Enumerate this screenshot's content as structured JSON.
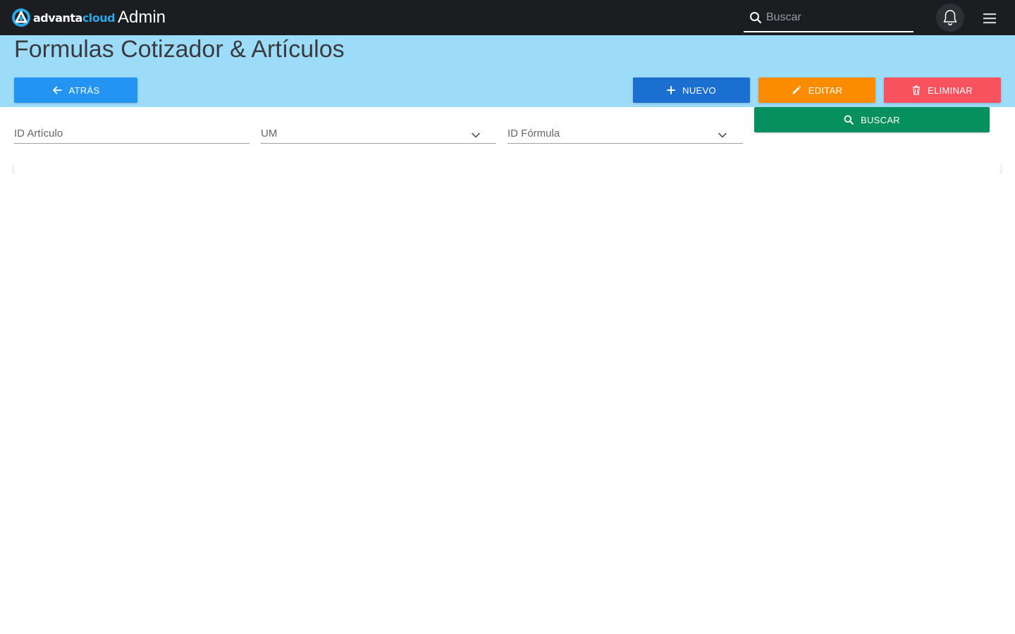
{
  "topbar": {
    "brand_part1": "advanta",
    "brand_part2": "cloud",
    "app_title": "Admin",
    "search_placeholder": "Buscar",
    "search_value": "",
    "icons": {
      "logo": "advantacloud-logo",
      "search": "search-icon",
      "bell": "bell-icon",
      "menu": "hamburger-menu-icon"
    }
  },
  "header": {
    "title": "Formulas Cotizador & Artículos",
    "buttons": {
      "back": "ATRÁS",
      "new": "NUEVO",
      "edit": "EDITAR",
      "delete": "ELIMINAR",
      "search": "BUSCAR"
    }
  },
  "filters": {
    "id_articulo": {
      "label": "ID Artículo",
      "value": ""
    },
    "um": {
      "label": "UM",
      "value": ""
    },
    "id_formula": {
      "label": "ID Fórmula",
      "value": ""
    }
  },
  "colors": {
    "topbar": "#1c1d21",
    "band": "#9cdcf8",
    "back": "#2394f2",
    "new": "#1b6fd1",
    "edit": "#fb8c00",
    "delete": "#f7525e",
    "search": "#06905f",
    "brand_accent": "#2aa8e6"
  }
}
